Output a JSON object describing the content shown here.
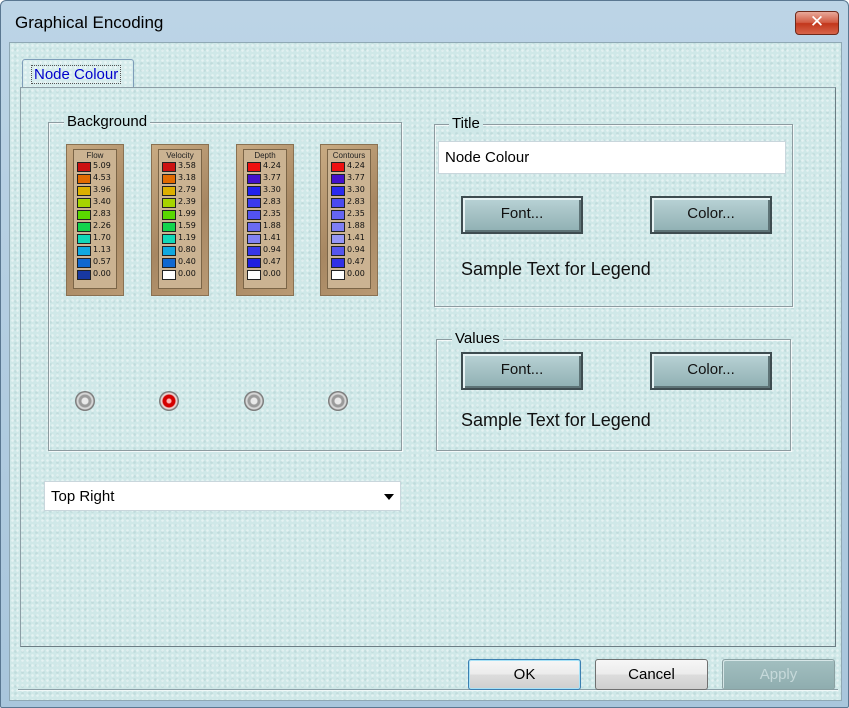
{
  "window": {
    "title": "Graphical Encoding",
    "close_label": "✕"
  },
  "tabs": [
    {
      "label": "Node Colour",
      "selected": true
    }
  ],
  "background": {
    "label": "Background",
    "legends": [
      {
        "title": "Flow",
        "values": [
          "5.09",
          "4.53",
          "3.96",
          "3.40",
          "2.83",
          "2.26",
          "1.70",
          "1.13",
          "0.57",
          "0.00"
        ],
        "colors": [
          "#cc1111",
          "#e26a00",
          "#ddb000",
          "#a6d400",
          "#5ad800",
          "#12d44c",
          "#10d8b8",
          "#10a8e0",
          "#1068d0",
          "#1838a0"
        ],
        "selected": false
      },
      {
        "title": "Velocity",
        "values": [
          "3.58",
          "3.18",
          "2.79",
          "2.39",
          "1.99",
          "1.59",
          "1.19",
          "0.80",
          "0.40",
          "0.00"
        ],
        "colors": [
          "#cc1111",
          "#e26a00",
          "#ddb000",
          "#a6d400",
          "#5ad800",
          "#12d44c",
          "#10d8b8",
          "#10a8e0",
          "#1068d0",
          "#ffffff"
        ],
        "selected": true
      },
      {
        "title": "Depth",
        "values": [
          "4.24",
          "3.77",
          "3.30",
          "2.83",
          "2.35",
          "1.88",
          "1.41",
          "0.94",
          "0.47",
          "0.00"
        ],
        "colors": [
          "#ee1010",
          "#4411cc",
          "#2222ee",
          "#3a3aee",
          "#5252f0",
          "#6a6af2",
          "#8282f4",
          "#3636e8",
          "#2020e0",
          "#ffffff"
        ],
        "selected": false
      },
      {
        "title": "Contours",
        "values": [
          "4.24",
          "3.77",
          "3.30",
          "2.83",
          "2.35",
          "1.88",
          "1.41",
          "0.94",
          "0.47",
          "0.00"
        ],
        "colors": [
          "#ee1010",
          "#4411cc",
          "#2a2aee",
          "#4a4af0",
          "#6464f2",
          "#7e7ef4",
          "#9696f6",
          "#5656ee",
          "#3030e6",
          "#ffffff"
        ],
        "selected": false
      }
    ],
    "position_select": {
      "value": "Top Right"
    }
  },
  "title_group": {
    "label": "Title",
    "text_value": "Node Colour",
    "font_button": "Font...",
    "color_button": "Color...",
    "sample": "Sample Text for Legend"
  },
  "values_group": {
    "label": "Values",
    "font_button": "Font...",
    "color_button": "Color...",
    "sample": "Sample Text for Legend"
  },
  "buttons": {
    "ok": "OK",
    "cancel": "Cancel",
    "apply": "Apply"
  }
}
